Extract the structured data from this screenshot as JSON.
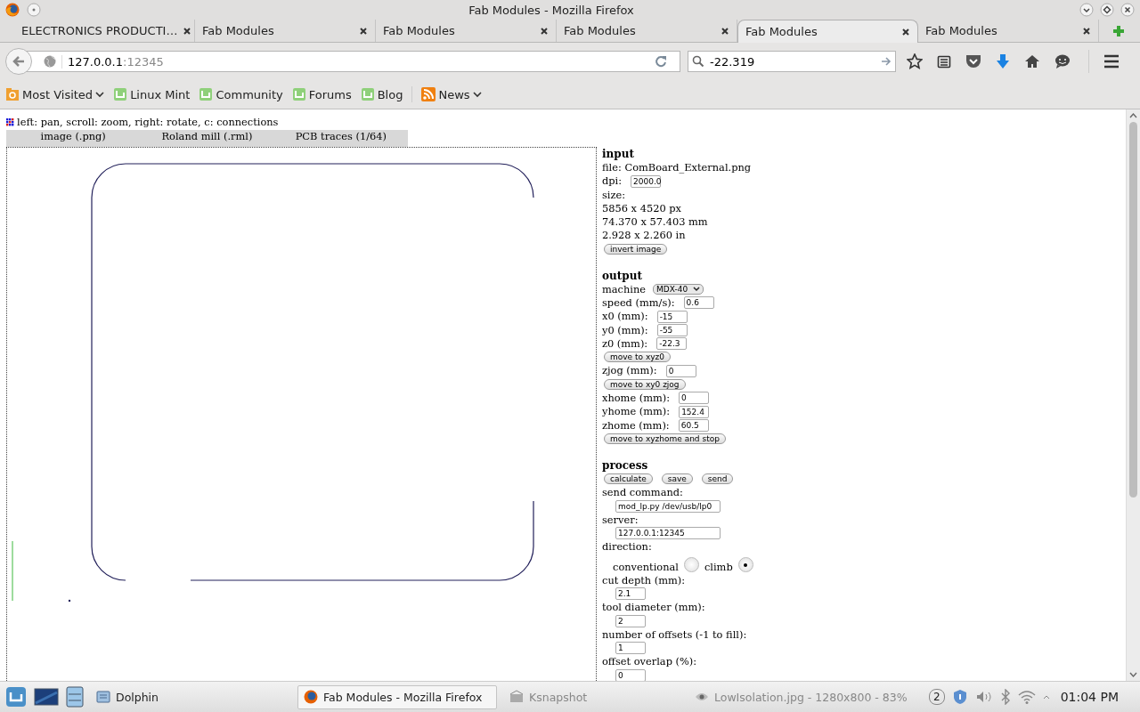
{
  "window": {
    "title": "Fab Modules - Mozilla Firefox"
  },
  "tabs": [
    {
      "label": "ELECTRONICS PRODUCTI…",
      "selected": false
    },
    {
      "label": "Fab Modules",
      "selected": false
    },
    {
      "label": "Fab Modules",
      "selected": false
    },
    {
      "label": "Fab Modules",
      "selected": false
    },
    {
      "label": "Fab Modules",
      "selected": true
    },
    {
      "label": "Fab Modules",
      "selected": false
    }
  ],
  "toolbar": {
    "url_host": "127.0.0.1",
    "url_port": ":12345",
    "search": "-22.319"
  },
  "bookmarks": [
    {
      "label": "Most Visited",
      "kind": "folder"
    },
    {
      "label": "Linux Mint",
      "kind": "link"
    },
    {
      "label": "Community",
      "kind": "link"
    },
    {
      "label": "Forums",
      "kind": "link"
    },
    {
      "label": "Blog",
      "kind": "link"
    },
    {
      "label": "News",
      "kind": "feed"
    }
  ],
  "page": {
    "hint": "left: pan, scroll: zoom, right: rotate, c: connections",
    "view_tabs": [
      "image (.png)",
      "Roland mill (.rml)",
      "PCB traces (1/64)"
    ],
    "sections": [
      {
        "title": "input",
        "rows": [
          {
            "kind": "text",
            "text": "file: ComBoard_External.png"
          },
          {
            "kind": "field",
            "label": "dpi:",
            "value": "2000.0"
          },
          {
            "kind": "text",
            "text": "size:"
          },
          {
            "kind": "text",
            "text": "5856 x 4520 px"
          },
          {
            "kind": "text",
            "text": "74.370 x 57.403 mm"
          },
          {
            "kind": "text",
            "text": "2.928 x 2.260 in"
          },
          {
            "kind": "buttons",
            "labels": [
              "invert image"
            ]
          }
        ]
      },
      {
        "title": "output",
        "rows": [
          {
            "kind": "select",
            "label": "machine",
            "value": "MDX-40"
          },
          {
            "kind": "field",
            "label": "speed (mm/s):",
            "value": "0.6"
          },
          {
            "kind": "field",
            "label": "x0 (mm):",
            "value": "-15"
          },
          {
            "kind": "field",
            "label": "y0 (mm):",
            "value": "-55"
          },
          {
            "kind": "field",
            "label": "z0 (mm):",
            "value": "-22.3"
          },
          {
            "kind": "buttons",
            "labels": [
              "move to xyz0"
            ]
          },
          {
            "kind": "field",
            "label": "zjog (mm):",
            "value": "0"
          },
          {
            "kind": "buttons",
            "labels": [
              "move to xy0 zjog"
            ]
          },
          {
            "kind": "field",
            "label": "xhome (mm):",
            "value": "0"
          },
          {
            "kind": "field",
            "label": "yhome (mm):",
            "value": "152.4"
          },
          {
            "kind": "field",
            "label": "zhome (mm):",
            "value": "60.5"
          },
          {
            "kind": "buttons",
            "labels": [
              "move to xyzhome and stop"
            ]
          }
        ]
      },
      {
        "title": "process",
        "rows": [
          {
            "kind": "buttons",
            "labels": [
              "calculate",
              "save",
              "send"
            ]
          },
          {
            "kind": "long-field",
            "label": "send command:",
            "value": "mod_lp.py /dev/usb/lp0"
          },
          {
            "kind": "long-field",
            "label": "server:",
            "value": "127.0.0.1:12345"
          },
          {
            "kind": "text",
            "text": "direction:"
          },
          {
            "kind": "radios",
            "options": [
              {
                "label": "conventional",
                "selected": false
              },
              {
                "label": "climb",
                "selected": true
              }
            ]
          },
          {
            "kind": "short-field",
            "label": "cut depth (mm):",
            "value": "2.1"
          },
          {
            "kind": "short-field",
            "label": "tool diameter (mm):",
            "value": "2"
          },
          {
            "kind": "short-field",
            "label": "number of offsets (-1 to fill):",
            "value": "1"
          },
          {
            "kind": "short-field",
            "label": "offset overlap (%):",
            "value": "0"
          }
        ]
      }
    ]
  },
  "taskbar": {
    "items": [
      {
        "label": "Dolphin",
        "kind": "files",
        "selected": false
      },
      {
        "label": "Fab Modules - Mozilla Firefox",
        "kind": "browser",
        "selected": true
      },
      {
        "label": "Ksnapshot",
        "kind": "camera",
        "selected": false
      },
      {
        "label": "LowIsolation.jpg - 1280x800 - 83%",
        "kind": "viewer",
        "selected": false
      }
    ],
    "badge": "2",
    "clock": "01:04 PM"
  }
}
